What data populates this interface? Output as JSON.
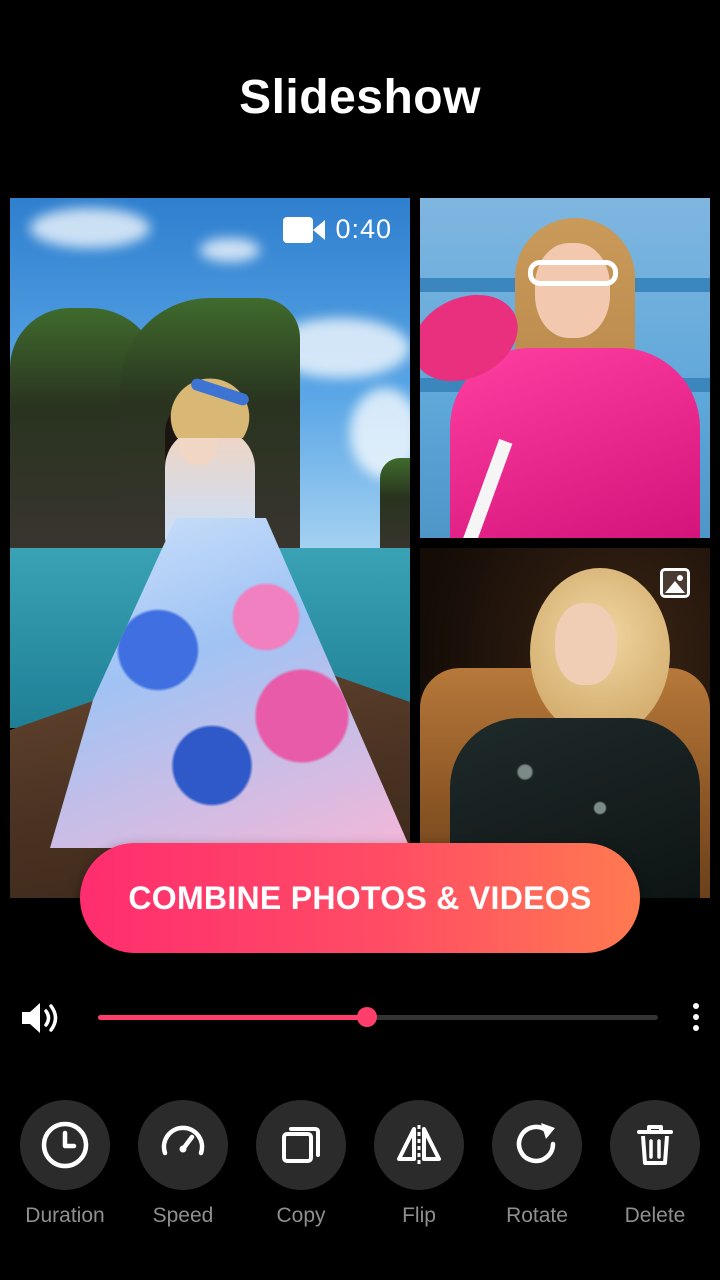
{
  "header": {
    "title": "Slideshow"
  },
  "media": {
    "main_video": {
      "duration": "0:40",
      "badge_icon": "video-camera-icon"
    },
    "top_photo": {},
    "bottom_photo": {
      "badge_icon": "image-icon"
    }
  },
  "cta": {
    "label": "COMBINE PHOTOS & VIDEOS"
  },
  "playback": {
    "volume_icon": "volume-icon",
    "progress": 0.48,
    "menu_icon": "more-vertical-icon"
  },
  "tools": [
    {
      "label": "Duration",
      "icon": "clock-icon"
    },
    {
      "label": "Speed",
      "icon": "speedometer-icon"
    },
    {
      "label": "Copy",
      "icon": "copy-icon"
    },
    {
      "label": "Flip",
      "icon": "flip-icon"
    },
    {
      "label": "Rotate",
      "icon": "rotate-icon"
    },
    {
      "label": "Delete",
      "icon": "trash-icon"
    }
  ],
  "colors": {
    "accent": "#ff3e6c",
    "background": "#000000",
    "tool_bg": "#2b2b2b",
    "label": "#8f8f8f"
  }
}
